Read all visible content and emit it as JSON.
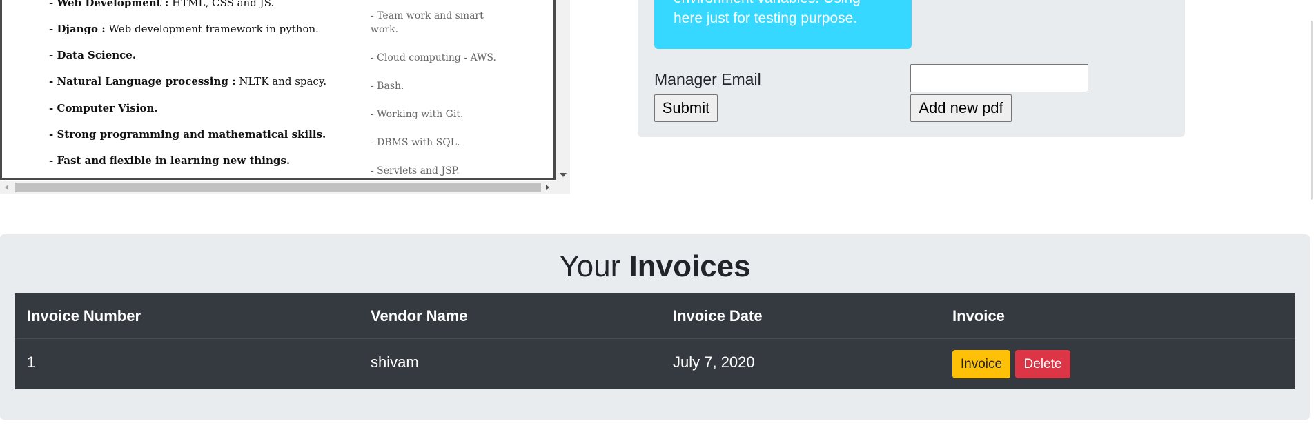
{
  "pdf": {
    "skills_left": [
      {
        "bold": "- Web Development :",
        "rest": " HTML, CSS and JS."
      },
      {
        "bold": "- Django :",
        "rest": " Web development framework in python."
      },
      {
        "bold": "- Data Science.",
        "rest": ""
      },
      {
        "bold": "- Natural Language processing :",
        "rest": " NLTK and spacy."
      },
      {
        "bold": "- Computer Vision.",
        "rest": ""
      },
      {
        "bold": "- Strong programming and mathematical skills.",
        "rest": ""
      },
      {
        "bold": "- Fast and flexible in learning new things.",
        "rest": ""
      }
    ],
    "skills_right": [
      "- Team work and smart work.",
      "- Cloud computing - AWS.",
      "- Bash.",
      "- Working with Git.",
      "- DBMS with SQL.",
      "- Servlets and JSP."
    ]
  },
  "form": {
    "alert_line1": "environment variables. Using",
    "alert_line2": "here just for testing purpose.",
    "manager_email_label": "Manager Email",
    "manager_email_value": "",
    "submit_label": "Submit",
    "add_pdf_label": "Add new pdf"
  },
  "invoices": {
    "title_regular": "Your ",
    "title_bold": "Invoices",
    "columns": [
      "Invoice Number",
      "Vendor Name",
      "Invoice Date",
      "Invoice"
    ],
    "rows": [
      {
        "number": "1",
        "vendor": "shivam",
        "date": "July 7, 2020",
        "invoice_btn": "Invoice",
        "delete_btn": "Delete"
      }
    ]
  },
  "colors": {
    "info_alert": "#36d8ff",
    "panel_bg": "#e9ecef",
    "table_dark": "#343a40",
    "invoice_btn": "#ffc107",
    "delete_btn": "#dc3545"
  }
}
